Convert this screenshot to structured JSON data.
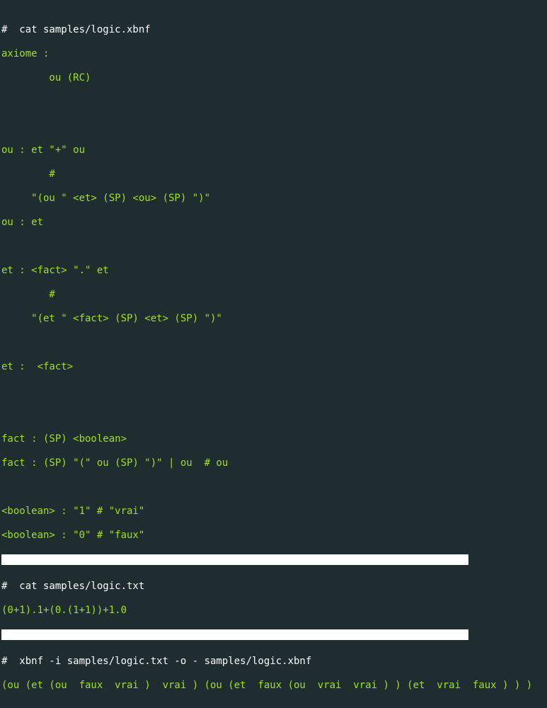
{
  "lines": {
    "0": "#  cat samples/logic.xbnf",
    "1": "axiome :",
    "2": "        ou (RC)",
    "3": "",
    "4": "",
    "5": "ou : et \"+\" ou",
    "6": "        #",
    "7": "     \"(ou \" <et> (SP) <ou> (SP) \")\"",
    "8": "ou : et",
    "9": "",
    "10": "et : <fact> \".\" et",
    "11": "        #",
    "12": "     \"(et \" <fact> (SP) <et> (SP) \")\"",
    "13": "",
    "14": "et :  <fact>",
    "15": "",
    "16": "",
    "17": "fact : (SP) <boolean>",
    "18": "fact : (SP) \"(\" ou (SP) \")\" | ou  # ou",
    "19": "",
    "20": "<boolean> : \"1\" # \"vrai\"",
    "21": "<boolean> : \"0\" # \"faux\"",
    "23": "#  cat samples/logic.txt",
    "24": "(0+1).1+(0.(1+1))+1.0",
    "26": "#  xbnf -i samples/logic.txt -o - samples/logic.xbnf",
    "27": "(ou (et (ou  faux  vrai )  vrai ) (ou (et  faux (ou  vrai  vrai ) ) (et  vrai  faux ) ) )"
  }
}
